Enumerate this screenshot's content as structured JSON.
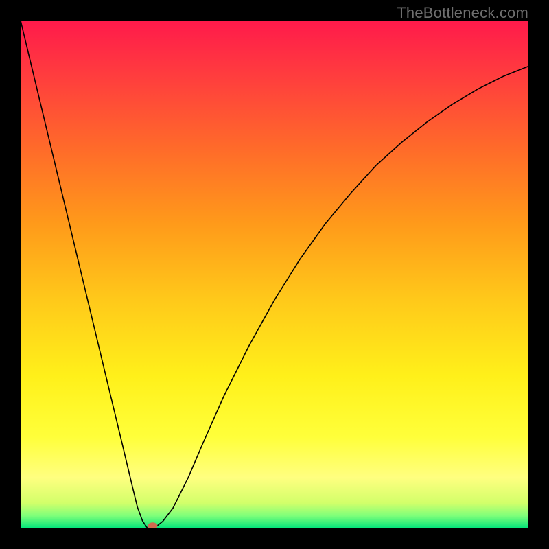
{
  "watermark": "TheBottleneck.com",
  "chart_data": {
    "type": "line",
    "title": "",
    "xlabel": "",
    "ylabel": "",
    "xlim": [
      0,
      100
    ],
    "ylim": [
      0,
      100
    ],
    "grid": false,
    "legend": false,
    "background_gradient": {
      "stops": [
        {
          "pos": 0.0,
          "color": "#ff1a4b"
        },
        {
          "pos": 0.1,
          "color": "#ff3a3f"
        },
        {
          "pos": 0.25,
          "color": "#ff6a2a"
        },
        {
          "pos": 0.4,
          "color": "#ff9a1a"
        },
        {
          "pos": 0.55,
          "color": "#ffc91a"
        },
        {
          "pos": 0.7,
          "color": "#fff01a"
        },
        {
          "pos": 0.82,
          "color": "#ffff3a"
        },
        {
          "pos": 0.9,
          "color": "#ffff80"
        },
        {
          "pos": 0.95,
          "color": "#d2ff6a"
        },
        {
          "pos": 0.975,
          "color": "#7fff7a"
        },
        {
          "pos": 1.0,
          "color": "#00e47a"
        }
      ]
    },
    "series": [
      {
        "name": "curve",
        "color": "#000000",
        "width": 1.6,
        "x": [
          0,
          3,
          6,
          9,
          12,
          15,
          18,
          20,
          22,
          23,
          24,
          25,
          26,
          27,
          28,
          30,
          33,
          36,
          40,
          45,
          50,
          55,
          60,
          65,
          70,
          75,
          80,
          85,
          90,
          95,
          100
        ],
        "y": [
          100,
          87.5,
          75,
          62.5,
          50,
          37.5,
          25,
          16.7,
          8.3,
          4.2,
          1.5,
          0,
          0,
          0.6,
          1.4,
          4.0,
          10,
          17,
          26,
          36,
          45,
          53,
          60,
          66,
          71.5,
          76,
          80,
          83.5,
          86.5,
          89,
          91
        ]
      }
    ],
    "markers": [
      {
        "name": "min-marker",
        "x": 26,
        "y": 0.5,
        "rx": 7,
        "ry": 5,
        "color": "#d16a4f"
      }
    ]
  }
}
